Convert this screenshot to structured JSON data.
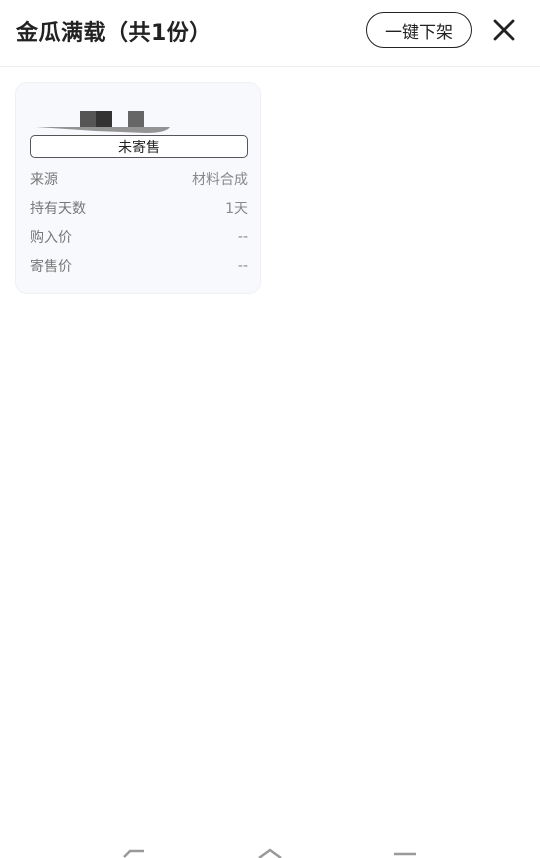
{
  "header": {
    "title": "金瓜满载（共1份）",
    "unlist_all_label": "一键下架",
    "close_icon": "close-icon"
  },
  "card": {
    "status_label": "未寄售",
    "rows": [
      {
        "label": "来源",
        "value": "材料合成"
      },
      {
        "label": "持有天数",
        "value": "1天"
      },
      {
        "label": "购入价",
        "value": "--"
      },
      {
        "label": "寄售价",
        "value": "--"
      }
    ]
  },
  "navbar": {
    "icons": [
      "back-icon",
      "home-icon",
      "menu-icon"
    ]
  }
}
